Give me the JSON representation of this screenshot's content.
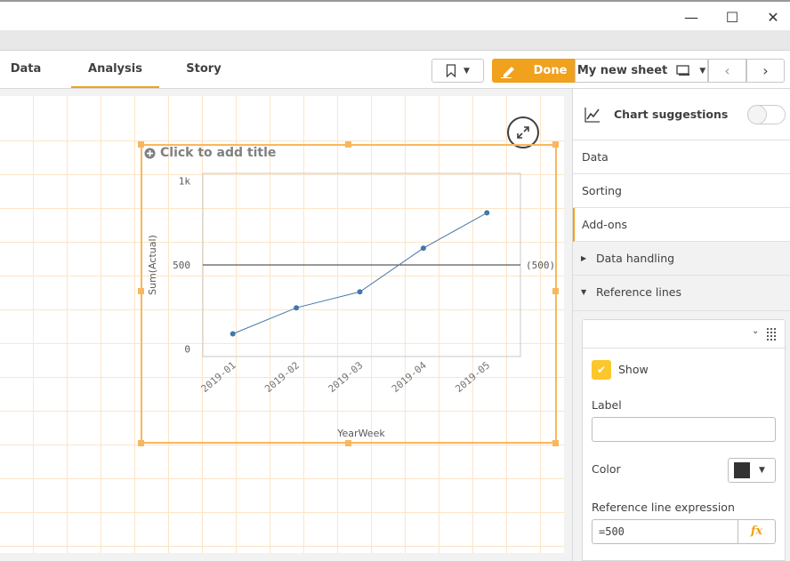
{
  "window": {
    "minimize": "—",
    "maximize": "☐",
    "close": "✕"
  },
  "tabs": [
    {
      "label": "Data"
    },
    {
      "label": "Analysis",
      "active": true
    },
    {
      "label": "Story"
    }
  ],
  "toolbar": {
    "done_label": "Done",
    "sheet_name": "My new sheet",
    "accent": "#f0a11d"
  },
  "chart": {
    "title_placeholder": "Click to add title"
  },
  "chart_data": {
    "type": "line",
    "categories": [
      "2019-01",
      "2019-02",
      "2019-03",
      "2019-04",
      "2019-05"
    ],
    "values": [
      90,
      245,
      340,
      600,
      810
    ],
    "xlabel": "YearWeek",
    "ylabel": "Sum(Actual)",
    "yticks": [
      "0",
      "500",
      "1k"
    ],
    "ylim": [
      -45,
      1045
    ],
    "reference_line": {
      "value": 500,
      "label": "(500)",
      "color": "#333333"
    },
    "line_color": "#4477aa",
    "grid": false
  },
  "panel": {
    "chart_suggestions": "Chart suggestions",
    "sections": [
      "Data",
      "Sorting",
      "Add-ons"
    ],
    "subsections": [
      "Data handling",
      "Reference lines"
    ],
    "refline": {
      "show_label": "Show",
      "show_checked": true,
      "label_label": "Label",
      "label_value": "",
      "color_label": "Color",
      "color_value": "#333333",
      "expr_label": "Reference line expression",
      "expr_value": "=500",
      "fx": "fx"
    }
  }
}
